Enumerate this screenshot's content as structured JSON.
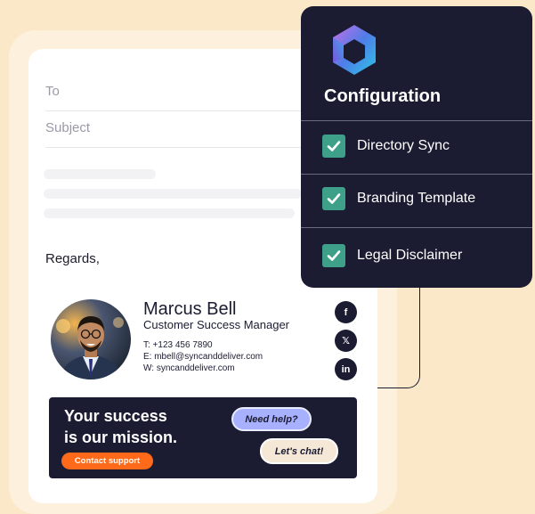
{
  "email": {
    "to_label": "To",
    "subject_label": "Subject",
    "closing": "Regards,"
  },
  "signature": {
    "name": "Marcus Bell",
    "title": "Customer Success Manager",
    "phone": "T: +123 456 7890",
    "email": "E: mbell@syncanddeliver.com",
    "website": "W: syncanddeliver.com",
    "social": [
      {
        "icon": "facebook-icon",
        "glyph": "f"
      },
      {
        "icon": "x-icon",
        "glyph": "𝕏"
      },
      {
        "icon": "linkedin-icon",
        "glyph": "in"
      }
    ]
  },
  "banner": {
    "line1": "Your success",
    "line2": "is our mission.",
    "cta": "Contact support",
    "bubble1": "Need help?",
    "bubble2": "Let's chat!"
  },
  "config": {
    "title": "Configuration",
    "items": [
      {
        "label": "Directory Sync",
        "checked": true
      },
      {
        "label": "Branding Template",
        "checked": true
      },
      {
        "label": "Legal Disclaimer",
        "checked": true
      }
    ]
  },
  "colors": {
    "background": "#fbe8c8",
    "panel": "#1b1c31",
    "check": "#3fa08a",
    "cta": "#ff6a1a",
    "bubble_blue": "#a7b1ff"
  }
}
